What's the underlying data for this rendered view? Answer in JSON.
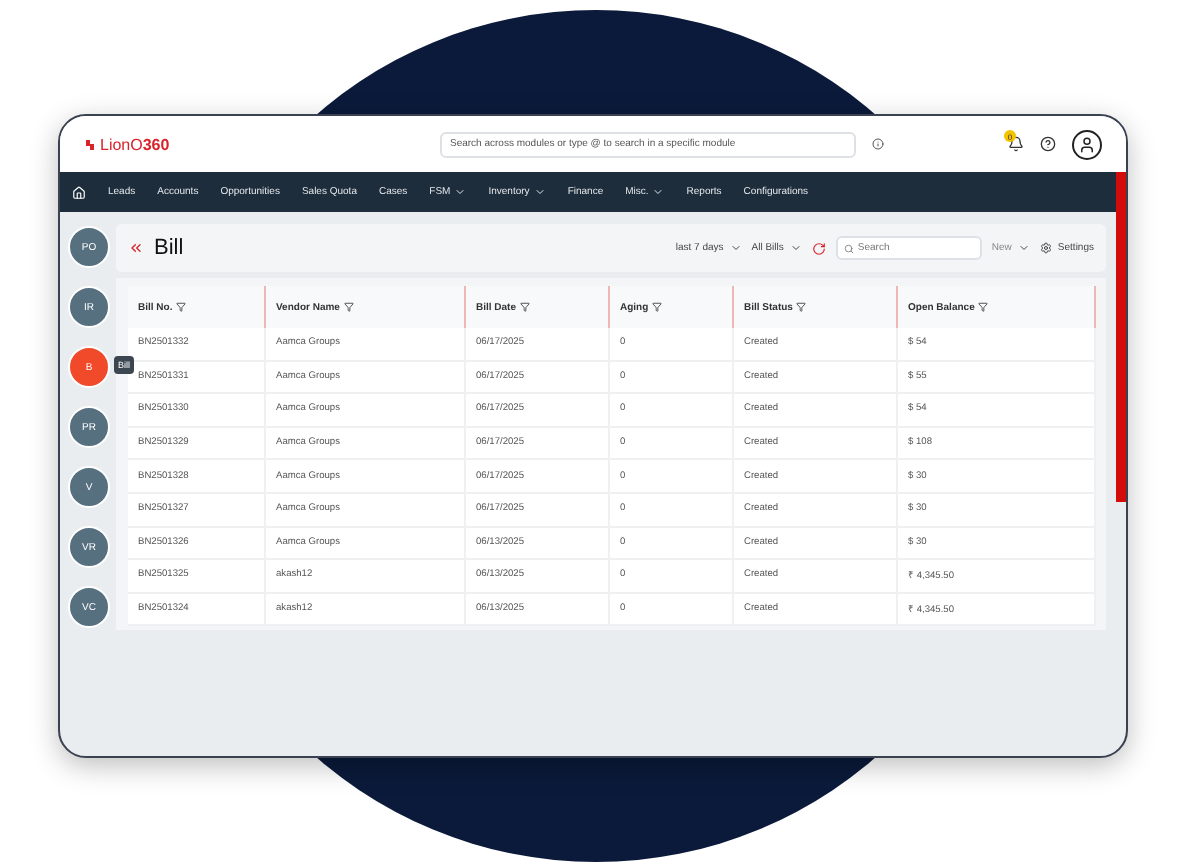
{
  "header": {
    "logo": "LionO**360**",
    "search": {
      "placeholder": "Search across modules or type @ to search in a specific module"
    },
    "notification_count": "0"
  },
  "nav": [
    {
      "label": "Leads",
      "dropdown": false
    },
    {
      "label": "Accounts",
      "dropdown": false
    },
    {
      "label": "Opportunities",
      "dropdown": false
    },
    {
      "label": "Sales Quota",
      "dropdown": false
    },
    {
      "label": "Cases",
      "dropdown": false
    },
    {
      "label": "FSM",
      "dropdown": true
    },
    {
      "label": "Inventory",
      "dropdown": true
    },
    {
      "label": "Finance",
      "dropdown": false
    },
    {
      "label": "Misc.",
      "dropdown": true
    },
    {
      "label": "Reports",
      "dropdown": false
    },
    {
      "label": "Configurations",
      "dropdown": false
    }
  ],
  "sidebar": {
    "items": [
      {
        "label": "PO",
        "selected": false
      },
      {
        "label": "IR",
        "selected": false
      },
      {
        "label": "B",
        "selected": true,
        "tooltip": "Bill"
      },
      {
        "label": "PR",
        "selected": false
      },
      {
        "label": "V",
        "selected": false
      },
      {
        "label": "VR",
        "selected": false
      },
      {
        "label": "VC",
        "selected": false
      }
    ]
  },
  "page": {
    "title": "Bill",
    "period": "last 7 days",
    "view": "All Bills",
    "search": {
      "placeholder": "Search"
    },
    "new_label": "New",
    "settings_label": "Settings"
  },
  "table": {
    "columns": [
      "Bill No.",
      "Vendor Name",
      "Bill Date",
      "Aging",
      "Bill Status",
      "Open Balance"
    ],
    "rows": [
      [
        "BN2501332",
        "Aamca Groups",
        "06/17/2025",
        "0",
        "Created",
        "$ 54"
      ],
      [
        "BN2501331",
        "Aamca Groups",
        "06/17/2025",
        "0",
        "Created",
        "$ 55"
      ],
      [
        "BN2501330",
        "Aamca Groups",
        "06/17/2025",
        "0",
        "Created",
        "$ 54"
      ],
      [
        "BN2501329",
        "Aamca Groups",
        "06/17/2025",
        "0",
        "Created",
        "$ 108"
      ],
      [
        "BN2501328",
        "Aamca Groups",
        "06/17/2025",
        "0",
        "Created",
        "$ 30"
      ],
      [
        "BN2501327",
        "Aamca Groups",
        "06/17/2025",
        "0",
        "Created",
        "$ 30"
      ],
      [
        "BN2501326",
        "Aamca Groups",
        "06/13/2025",
        "0",
        "Created",
        "$ 30"
      ],
      [
        "BN2501325",
        "akash12",
        "06/13/2025",
        "0",
        "Created",
        "₹ 4,345.50"
      ],
      [
        "BN2501324",
        "akash12",
        "06/13/2025",
        "0",
        "Created",
        "₹ 4,345.50"
      ]
    ]
  }
}
